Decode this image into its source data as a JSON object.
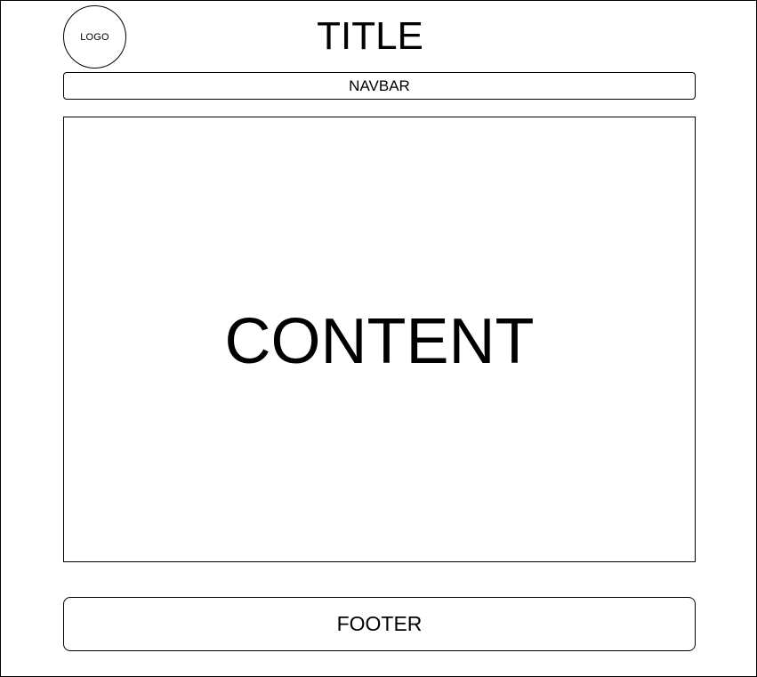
{
  "header": {
    "logo_label": "LOGO",
    "title": "TITLE"
  },
  "navbar": {
    "label": "NAVBAR"
  },
  "content": {
    "label": "CONTENT"
  },
  "footer": {
    "label": "FOOTER"
  },
  "colors": {
    "stroke": "#000000",
    "background": "#ffffff"
  }
}
